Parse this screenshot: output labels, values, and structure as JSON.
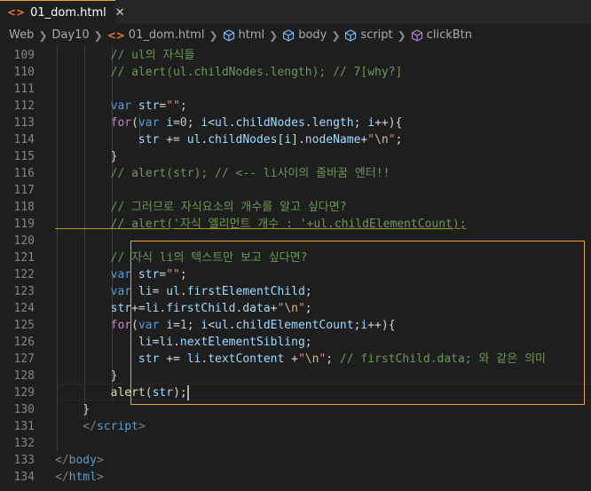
{
  "tab": {
    "icon": "<>",
    "filename": "01_dom.html",
    "close": "✕"
  },
  "breadcrumb": {
    "items": [
      "Web",
      "Day10",
      "01_dom.html",
      "html",
      "body",
      "script",
      "clickBtn"
    ],
    "icon_html": "<>"
  },
  "lines": [
    {
      "n": "109",
      "tokens": [
        [
          "c-com",
          "        // ul의 자식들"
        ]
      ]
    },
    {
      "n": "110",
      "tokens": [
        [
          "c-com",
          "        // alert(ul.childNodes.length); // 7[why?]"
        ]
      ]
    },
    {
      "n": "111",
      "tokens": []
    },
    {
      "n": "112",
      "tokens": [
        [
          "c-kw",
          "        var"
        ],
        [
          "c-plain",
          " "
        ],
        [
          "c-var",
          "str"
        ],
        [
          "c-plain",
          "="
        ],
        [
          "c-str",
          "\"\""
        ],
        [
          "c-plain",
          ";"
        ]
      ]
    },
    {
      "n": "113",
      "tokens": [
        [
          "c-ctrl",
          "        for"
        ],
        [
          "c-plain",
          "("
        ],
        [
          "c-kw",
          "var"
        ],
        [
          "c-plain",
          " "
        ],
        [
          "c-var",
          "i"
        ],
        [
          "c-plain",
          "="
        ],
        [
          "c-num",
          "0"
        ],
        [
          "c-plain",
          "; "
        ],
        [
          "c-var",
          "i"
        ],
        [
          "c-plain",
          "<"
        ],
        [
          "c-var",
          "ul"
        ],
        [
          "c-plain",
          "."
        ],
        [
          "c-var",
          "childNodes"
        ],
        [
          "c-plain",
          "."
        ],
        [
          "c-var",
          "length"
        ],
        [
          "c-plain",
          "; "
        ],
        [
          "c-var",
          "i"
        ],
        [
          "c-plain",
          "++){"
        ]
      ]
    },
    {
      "n": "114",
      "tokens": [
        [
          "c-var",
          "            str"
        ],
        [
          "c-plain",
          " += "
        ],
        [
          "c-var",
          "ul"
        ],
        [
          "c-plain",
          "."
        ],
        [
          "c-var",
          "childNodes"
        ],
        [
          "c-plain",
          "["
        ],
        [
          "c-var",
          "i"
        ],
        [
          "c-plain",
          "]."
        ],
        [
          "c-var",
          "nodeName"
        ],
        [
          "c-plain",
          "+"
        ],
        [
          "c-str",
          "\""
        ],
        [
          "c-esc",
          "\\n"
        ],
        [
          "c-str",
          "\""
        ],
        [
          "c-plain",
          ";"
        ]
      ]
    },
    {
      "n": "115",
      "tokens": [
        [
          "c-plain",
          "        }"
        ]
      ]
    },
    {
      "n": "116",
      "tokens": [
        [
          "c-com",
          "        // alert(str); // <-- li사이의 줄바꿈 엔터!!"
        ]
      ]
    },
    {
      "n": "117",
      "tokens": []
    },
    {
      "n": "118",
      "tokens": [
        [
          "c-com",
          "        // 그러므로 자식요소의 개수를 알고 싶다면?"
        ]
      ]
    },
    {
      "n": "119",
      "tokens": [
        [
          "c-com",
          "        // alert('자식 엘리먼트 개수 : '+ul.childElementCount);"
        ]
      ]
    },
    {
      "n": "120",
      "tokens": []
    },
    {
      "n": "121",
      "tokens": [
        [
          "c-com",
          "        // 자식 li의 텍스트만 보고 싶다면?"
        ]
      ]
    },
    {
      "n": "122",
      "tokens": [
        [
          "c-kw",
          "        var"
        ],
        [
          "c-plain",
          " "
        ],
        [
          "c-var",
          "str"
        ],
        [
          "c-plain",
          "="
        ],
        [
          "c-str",
          "\"\""
        ],
        [
          "c-plain",
          ";"
        ]
      ]
    },
    {
      "n": "123",
      "tokens": [
        [
          "c-kw",
          "        var"
        ],
        [
          "c-plain",
          " "
        ],
        [
          "c-var",
          "li"
        ],
        [
          "c-plain",
          "= "
        ],
        [
          "c-var",
          "ul"
        ],
        [
          "c-plain",
          "."
        ],
        [
          "c-var",
          "firstElementChild"
        ],
        [
          "c-plain",
          ";"
        ]
      ]
    },
    {
      "n": "124",
      "tokens": [
        [
          "c-var",
          "        str"
        ],
        [
          "c-plain",
          "+="
        ],
        [
          "c-var",
          "li"
        ],
        [
          "c-plain",
          "."
        ],
        [
          "c-var",
          "firstChild"
        ],
        [
          "c-plain",
          "."
        ],
        [
          "c-var",
          "data"
        ],
        [
          "c-plain",
          "+"
        ],
        [
          "c-str",
          "\""
        ],
        [
          "c-esc",
          "\\n"
        ],
        [
          "c-str",
          "\""
        ],
        [
          "c-plain",
          ";"
        ]
      ]
    },
    {
      "n": "125",
      "tokens": [
        [
          "c-ctrl",
          "        for"
        ],
        [
          "c-plain",
          "("
        ],
        [
          "c-kw",
          "var"
        ],
        [
          "c-plain",
          " "
        ],
        [
          "c-var",
          "i"
        ],
        [
          "c-plain",
          "="
        ],
        [
          "c-num",
          "1"
        ],
        [
          "c-plain",
          "; "
        ],
        [
          "c-var",
          "i"
        ],
        [
          "c-plain",
          "<"
        ],
        [
          "c-var",
          "ul"
        ],
        [
          "c-plain",
          "."
        ],
        [
          "c-var",
          "childElementCount"
        ],
        [
          "c-plain",
          ";"
        ],
        [
          "c-var",
          "i"
        ],
        [
          "c-plain",
          "++){"
        ]
      ]
    },
    {
      "n": "126",
      "tokens": [
        [
          "c-var",
          "            li"
        ],
        [
          "c-plain",
          "="
        ],
        [
          "c-var",
          "li"
        ],
        [
          "c-plain",
          "."
        ],
        [
          "c-var",
          "nextElementSibling"
        ],
        [
          "c-plain",
          ";"
        ]
      ]
    },
    {
      "n": "127",
      "tokens": [
        [
          "c-var",
          "            str"
        ],
        [
          "c-plain",
          " += "
        ],
        [
          "c-var",
          "li"
        ],
        [
          "c-plain",
          "."
        ],
        [
          "c-var",
          "textContent"
        ],
        [
          "c-plain",
          " +"
        ],
        [
          "c-str",
          "\""
        ],
        [
          "c-esc",
          "\\n"
        ],
        [
          "c-str",
          "\""
        ],
        [
          "c-plain",
          "; "
        ],
        [
          "c-com",
          "// firstChild.data; 와 같은 의미"
        ]
      ]
    },
    {
      "n": "128",
      "tokens": [
        [
          "c-plain",
          "        }"
        ]
      ]
    },
    {
      "n": "129",
      "tokens": [
        [
          "c-fn",
          "        alert"
        ],
        [
          "c-plain",
          "("
        ],
        [
          "c-var",
          "str"
        ],
        [
          "c-plain",
          ");"
        ]
      ]
    },
    {
      "n": "130",
      "tokens": [
        [
          "c-plain",
          "    }"
        ]
      ]
    },
    {
      "n": "131",
      "tokens": [
        [
          "c-punc",
          "    </"
        ],
        [
          "c-tag",
          "script"
        ],
        [
          "c-punc",
          ">"
        ]
      ]
    },
    {
      "n": "132",
      "tokens": []
    },
    {
      "n": "133",
      "tokens": [
        [
          "c-punc",
          "</"
        ],
        [
          "c-tag",
          "body"
        ],
        [
          "c-punc",
          ">"
        ]
      ]
    },
    {
      "n": "134",
      "tokens": [
        [
          "c-punc",
          "</"
        ],
        [
          "c-tag",
          "html"
        ],
        [
          "c-punc",
          ">"
        ]
      ]
    }
  ]
}
